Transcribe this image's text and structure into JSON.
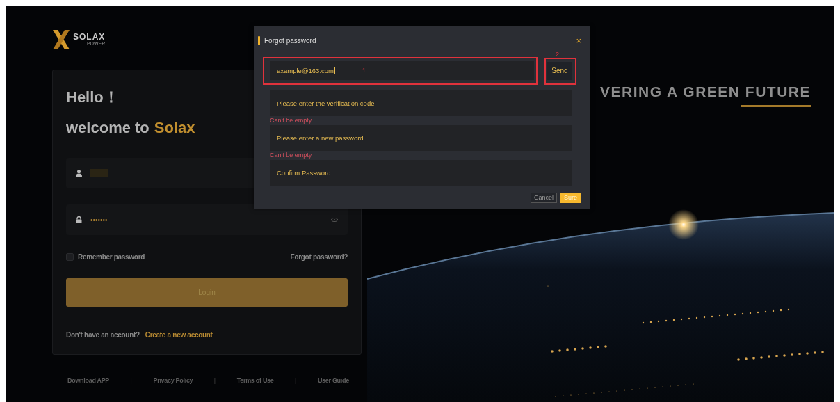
{
  "logo": {
    "text": "SOLAX",
    "subtext": "POWER"
  },
  "login": {
    "greeting": "Hello！",
    "welcome": "welcome to",
    "brand": "Solax",
    "username": {
      "redacted": true
    },
    "password": {
      "value": "•••••••"
    },
    "remember": {
      "label": "Remember password",
      "checked": false
    },
    "forgot": "Forgot password?",
    "login_button": {
      "label": "Login",
      "disabled": true
    },
    "signup_prompt": "Don't have an account?",
    "signup_link": "Create a new account"
  },
  "footer_links": [
    "Download APP",
    "Privacy Policy",
    "Terms of Use",
    "User Guide"
  ],
  "footer_separator": "|",
  "slogan": "VERING A GREEN FUTURE",
  "dialog": {
    "title": "Forgot password",
    "close": "×",
    "email": {
      "value": "example@163.com"
    },
    "send": "Send",
    "fields": [
      {
        "placeholder": "Please enter the verification code",
        "error": "Can't be empty"
      },
      {
        "placeholder": "Please enter a new password",
        "error": "Can't be empty"
      },
      {
        "placeholder": "Confirm Password"
      }
    ],
    "cancel": "Cancel",
    "sure": "Sure"
  },
  "annotations": [
    {
      "label": "1",
      "kind": "email"
    },
    {
      "label": "2",
      "kind": "send"
    }
  ]
}
